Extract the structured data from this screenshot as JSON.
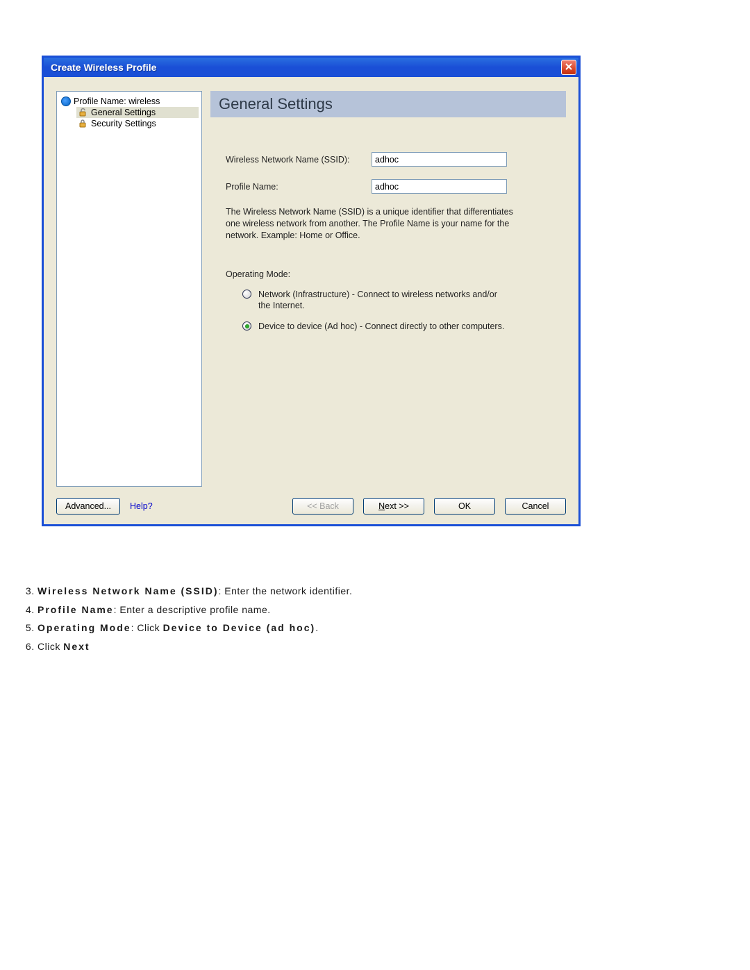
{
  "window": {
    "title": "Create Wireless Profile"
  },
  "tree": {
    "root": "Profile Name: wireless",
    "child1": "General Settings",
    "child2": "Security Settings"
  },
  "header": "General Settings",
  "form": {
    "ssid_label": "Wireless Network Name (SSID):",
    "ssid_value": "adhoc",
    "profile_label": "Profile Name:",
    "profile_value": "adhoc",
    "help_text": "The Wireless Network Name (SSID) is a unique identifier that differentiates one wireless network from another. The Profile Name is your name for the network. Example: Home or Office.",
    "mode_label": "Operating Mode:",
    "radio1": "Network (Infrastructure) - Connect to wireless networks and/or the Internet.",
    "radio2": "Device to device (Ad hoc) - Connect directly to other computers."
  },
  "buttons": {
    "advanced": "Advanced...",
    "help": "Help?",
    "back": "<< Back",
    "next_u": "N",
    "next_rest": "ext >>",
    "ok": "OK",
    "cancel": "Cancel"
  },
  "instructions": {
    "i3a": "Wireless Network Name (SSID)",
    "i3b": ": Enter the network identifier.",
    "i4a": "Profile Name",
    "i4b": ": Enter a descriptive profile name.",
    "i5a": "Operating Mode",
    "i5b": ": Click ",
    "i5c": "Device to Device (ad hoc)",
    "i5d": ".",
    "i6a": "Click ",
    "i6b": "Next"
  }
}
